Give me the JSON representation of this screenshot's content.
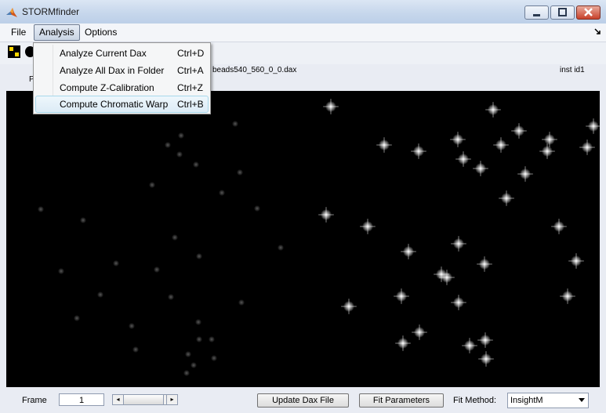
{
  "window": {
    "title": "STORMfinder",
    "app_icon": "matlab-icon",
    "controls": [
      "minimize-icon",
      "maximize-icon",
      "close-icon"
    ]
  },
  "menubar": {
    "items": [
      {
        "label": "File"
      },
      {
        "label": "Analysis"
      },
      {
        "label": "Options"
      }
    ],
    "overflow_icon": "dock-arrow-icon"
  },
  "analysis_menu": {
    "items": [
      {
        "label": "Analyze Current Dax",
        "shortcut": "Ctrl+D"
      },
      {
        "label": "Analyze All Dax in Folder",
        "shortcut": "Ctrl+A"
      },
      {
        "label": "Compute Z-Calibration",
        "shortcut": "Ctrl+Z"
      },
      {
        "label": "Compute Chromatic Warp",
        "shortcut": "Ctrl+B"
      }
    ]
  },
  "toolbar": {
    "tools": [
      "grid-tool-icon",
      "circle-tool-icon"
    ]
  },
  "file_info": {
    "prefix_fragment": "P",
    "filename_fragment": "beads540_560_0_0.dax",
    "instance_id": "inst id1"
  },
  "bottom": {
    "frame_label": "Frame",
    "frame_value": "1",
    "update_button": "Update Dax File",
    "fit_button": "Fit Parameters",
    "fit_method_label": "Fit Method:",
    "fit_method_value": "InsightM"
  },
  "colors": {
    "viewer_background": "#000000",
    "menu_highlight": "#dcebf6"
  }
}
